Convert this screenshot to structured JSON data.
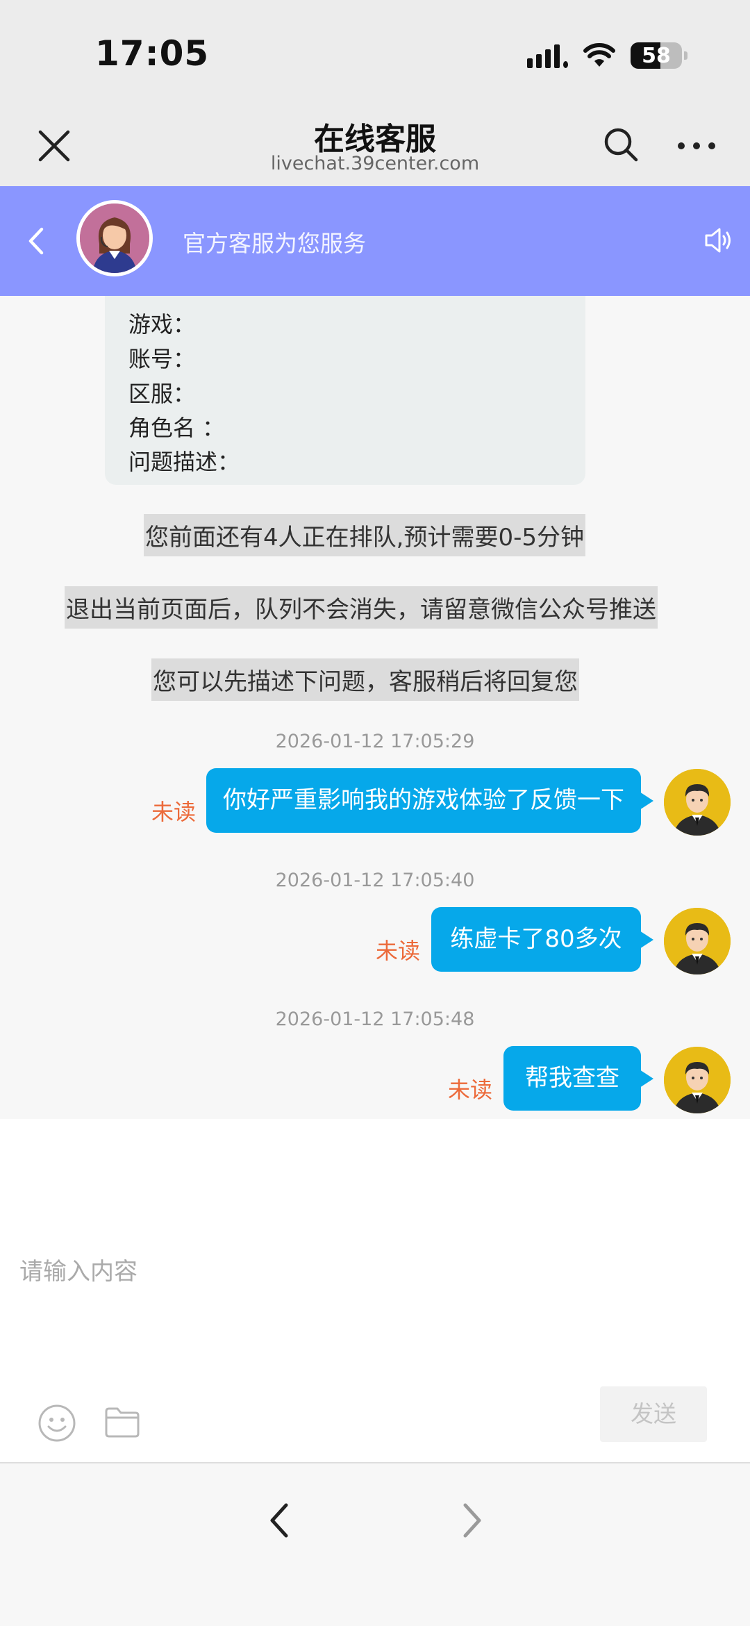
{
  "status_bar": {
    "time": "17:05",
    "battery": "58",
    "battery_level": 0.58
  },
  "browser_nav": {
    "title": "在线客服",
    "url": "livechat.39center.com",
    "icons": [
      "close-icon",
      "search-icon",
      "more-icon"
    ]
  },
  "chat_header": {
    "subtitle": "官方客服为您服务",
    "icons": [
      "back-icon",
      "speaker-icon"
    ],
    "color": "#8a96ff"
  },
  "form_card": {
    "lines": [
      "游戏：",
      "账号：",
      "区服：",
      "角色名 ：",
      "问题描述："
    ]
  },
  "system_messages": [
    "您前面还有4人正在排队,预计需要0-5分钟",
    "退出当前页面后，队列不会消失，请留意微信公众号推送",
    "您可以先描述下问题，客服稍后将回复您"
  ],
  "messages": [
    {
      "timestamp": "2026-01-12 17:05:29",
      "text": "你好严重影响我的游戏体验了反馈一下",
      "status": "未读"
    },
    {
      "timestamp": "2026-01-12 17:05:40",
      "text": "练虚卡了80多次",
      "status": "未读"
    },
    {
      "timestamp": "2026-01-12 17:05:48",
      "text": "帮我查查",
      "status": "未读"
    }
  ],
  "composer": {
    "placeholder": "请输入内容",
    "send_label": "发送",
    "icons": [
      "emoji-icon",
      "folder-icon"
    ]
  },
  "bottom_toolbar": {
    "icons": [
      "back-arrow-icon",
      "forward-arrow-icon"
    ]
  },
  "colors": {
    "bubble": "#06a8ea",
    "unread": "#ec6a3a"
  }
}
